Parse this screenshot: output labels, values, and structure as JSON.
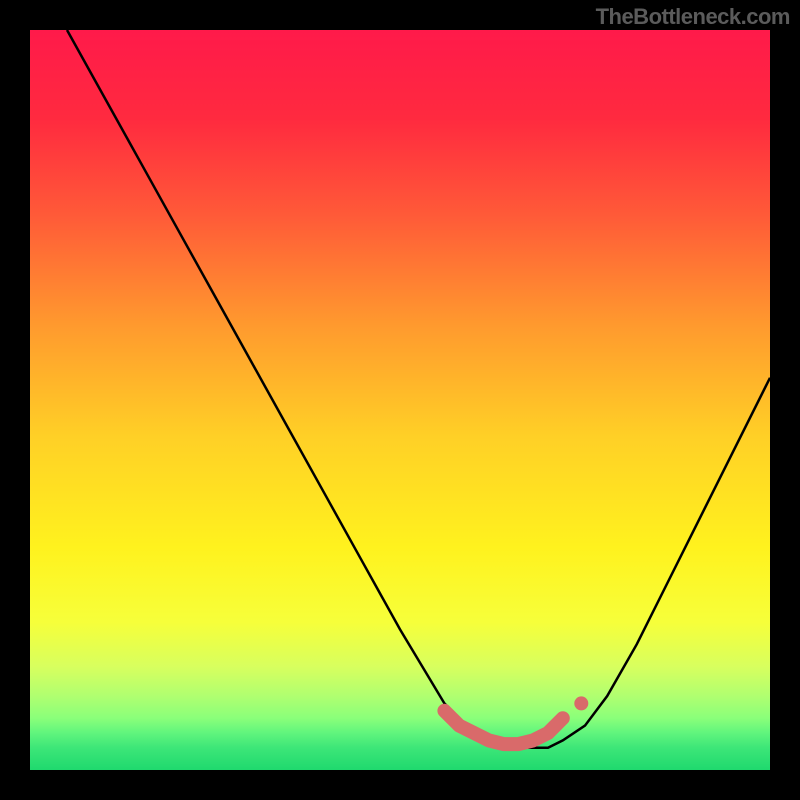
{
  "watermark": "TheBottleneck.com",
  "chart_data": {
    "type": "line",
    "title": "",
    "xlabel": "",
    "ylabel": "",
    "xlim": [
      0,
      100
    ],
    "ylim": [
      0,
      100
    ],
    "series": [
      {
        "name": "bottleneck-curve",
        "x": [
          5,
          10,
          15,
          20,
          25,
          30,
          35,
          40,
          45,
          50,
          53,
          56,
          59,
          62,
          65,
          68,
          70,
          72,
          75,
          78,
          82,
          86,
          90,
          95,
          100
        ],
        "y": [
          100,
          91,
          82,
          73,
          64,
          55,
          46,
          37,
          28,
          19,
          14,
          9,
          6,
          4,
          3,
          3,
          3,
          4,
          6,
          10,
          17,
          25,
          33,
          43,
          53
        ]
      },
      {
        "name": "highlight-band",
        "x": [
          56,
          58,
          60,
          62,
          64,
          66,
          68,
          70,
          72
        ],
        "y": [
          8,
          6,
          5,
          4,
          3.5,
          3.5,
          4,
          5,
          7
        ]
      }
    ],
    "gradient_stops": [
      {
        "offset": 0,
        "color": "#ff1a4a"
      },
      {
        "offset": 12,
        "color": "#ff2a3f"
      },
      {
        "offset": 25,
        "color": "#ff5a38"
      },
      {
        "offset": 40,
        "color": "#ff9a2e"
      },
      {
        "offset": 55,
        "color": "#ffd026"
      },
      {
        "offset": 70,
        "color": "#fff21e"
      },
      {
        "offset": 80,
        "color": "#f6ff3a"
      },
      {
        "offset": 86,
        "color": "#d8ff5e"
      },
      {
        "offset": 90,
        "color": "#b0ff70"
      },
      {
        "offset": 93,
        "color": "#8aff7a"
      },
      {
        "offset": 95,
        "color": "#60f57d"
      },
      {
        "offset": 97,
        "color": "#3de678"
      },
      {
        "offset": 100,
        "color": "#1fd96e"
      }
    ],
    "colors": {
      "curve": "#000000",
      "highlight": "#d96a6a"
    }
  }
}
